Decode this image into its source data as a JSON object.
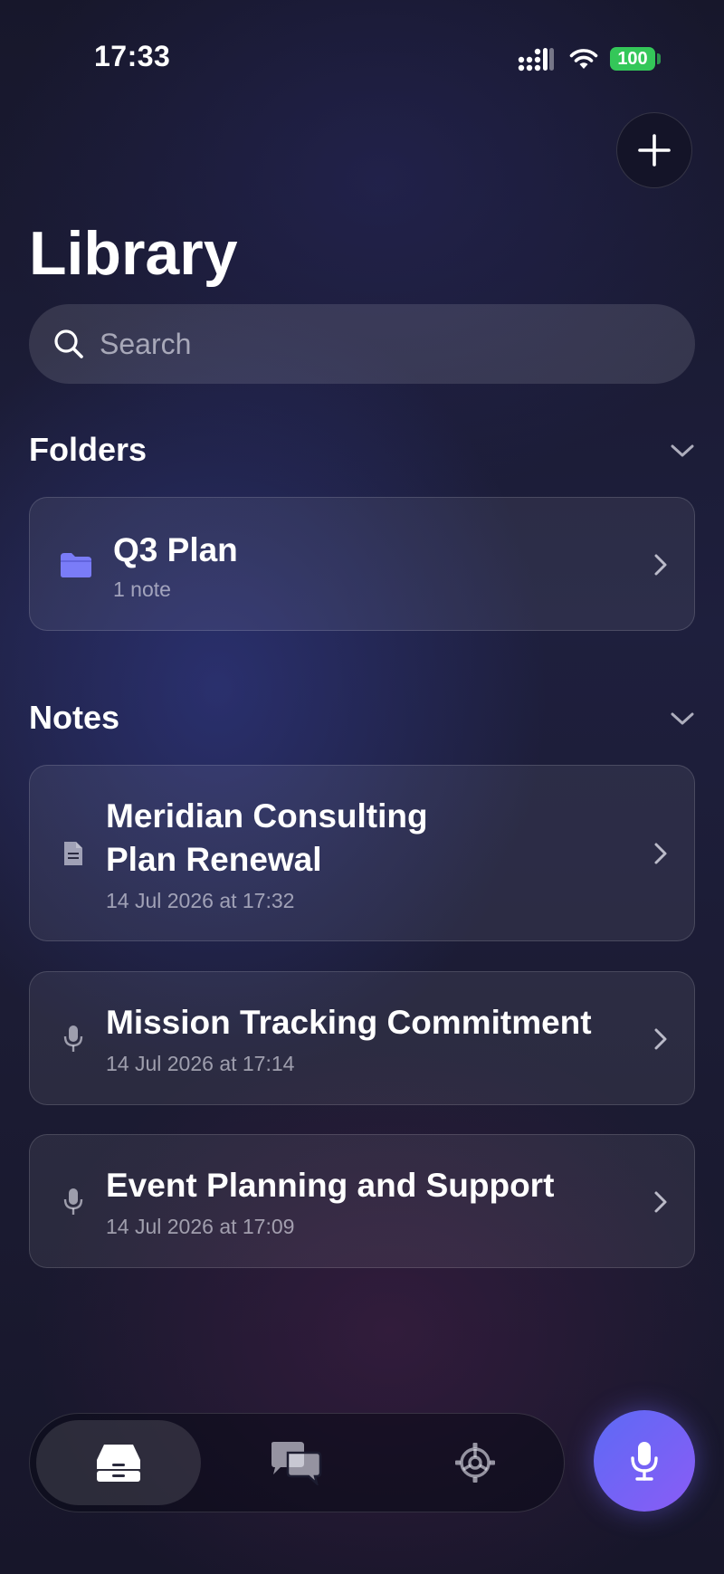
{
  "status_bar": {
    "time": "17:33",
    "battery": "100"
  },
  "header": {
    "title": "Library"
  },
  "search": {
    "placeholder": "Search"
  },
  "folders": {
    "heading": "Folders",
    "items": [
      {
        "name": "Q3 Plan",
        "count": "1 note",
        "icon": "folder-icon"
      }
    ]
  },
  "notes": {
    "heading": "Notes",
    "items": [
      {
        "title_line1": "Meridian Consulting",
        "title_line2": "Plan Renewal",
        "date": "14 Jul 2026 at 17:32",
        "icon": "document-icon"
      },
      {
        "title": "Mission Tracking Commitment",
        "date": "14 Jul 2026 at 17:14",
        "icon": "microphone-icon"
      },
      {
        "title": "Event Planning and Support",
        "date": "14 Jul 2026 at 17:09",
        "icon": "microphone-icon"
      }
    ]
  },
  "tabbar": {
    "tabs": [
      {
        "name": "library",
        "icon": "tray-icon",
        "active": true
      },
      {
        "name": "chat",
        "icon": "chat-bubbles-icon",
        "active": false
      },
      {
        "name": "settings",
        "icon": "gear-icon",
        "active": false
      }
    ],
    "record_icon": "microphone-icon"
  },
  "colors": {
    "accent_start": "#5d6af5",
    "accent_end": "#8a5cf5",
    "folder": "#7a7cf8",
    "battery": "#34c759"
  }
}
